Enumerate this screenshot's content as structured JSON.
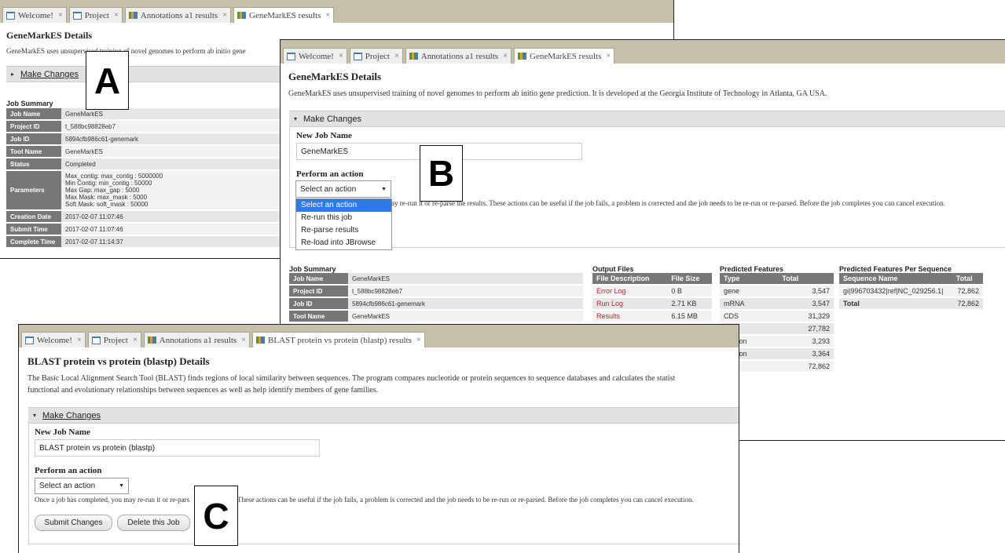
{
  "tabs": {
    "welcome": "Welcome!",
    "project": "Project",
    "annotations": "Annotations a1 results",
    "genemark": "GeneMarkES results",
    "blast": "BLAST protein vs protein (blastp) results",
    "close": "×"
  },
  "panelA": {
    "letter": "A",
    "title": "GeneMarkES Details",
    "description": "GeneMarkES uses unsupervised training of novel genomes to perform ab initio gene",
    "make_changes": "Make Changes",
    "job_summary_label": "Job Summary",
    "job_summary": [
      {
        "k": "Job Name",
        "v": "GeneMarkES"
      },
      {
        "k": "Project ID",
        "v": "t_588bc98828eb7"
      },
      {
        "k": "Job ID",
        "v": "5894cfb986c61-genemark"
      },
      {
        "k": "Tool Name",
        "v": "GeneMarkES"
      },
      {
        "k": "Status",
        "v": "Completed"
      },
      {
        "k": "Parameters",
        "v": [
          "Max_contig: max_contig : 5000000",
          "Min Contig: min_contig : 50000",
          "Max Gap: max_gap : 5000",
          "Max Mask: max_mask : 5000",
          "Soft Mask: soft_mask : 50000"
        ]
      },
      {
        "k": "Creation Date",
        "v": "2017-02-07 11:07:46"
      },
      {
        "k": "Submit Time",
        "v": "2017-02-07 11:07:46"
      },
      {
        "k": "Complete Time",
        "v": "2017-02-07 11:14:37"
      }
    ]
  },
  "panelB": {
    "letter": "B",
    "title": "GeneMarkES Details",
    "description": "GeneMarkES uses unsupervised training of novel genomes to perform ab initio gene prediction. It is developed at the Georgia Institute of Technology in Atlanta, GA USA.",
    "make_changes": "Make Changes",
    "new_job_name_label": "New Job Name",
    "new_job_name_value": "GeneMarkES",
    "perform_action_label": "Perform an action",
    "select_value": "Select an action",
    "dropdown_options": [
      "Select an action",
      "Re-run this job",
      "Re-parse results",
      "Re-load into JBrowse"
    ],
    "help_text": "ay re-run it or re-parse the results. These actions can be useful if the job fails, a problem is corrected and the job needs to be re-run or re-parsed. Before the job completes you can cancel execution.",
    "job_summary_label": "Job Summary",
    "job_summary": [
      {
        "k": "Job Name",
        "v": "GeneMarkES"
      },
      {
        "k": "Project ID",
        "v": "t_588bc98828eb7"
      },
      {
        "k": "Job ID",
        "v": "5894cfb986c61-genemark"
      },
      {
        "k": "Tool Name",
        "v": "GeneMarkES"
      }
    ],
    "output_files_label": "Output Files",
    "output_files_headers": [
      "File Description",
      "File Size"
    ],
    "output_files": [
      {
        "name": "Error Log",
        "size": "0 B"
      },
      {
        "name": "Run Log",
        "size": "2.71 KB"
      },
      {
        "name": "Results",
        "size": "6.15 MB"
      }
    ],
    "predicted_features_label": "Predicted Features",
    "predicted_features_headers": [
      "Type",
      "Total"
    ],
    "predicted_features": [
      {
        "type": "gene",
        "total": "3,547"
      },
      {
        "type": "mRNA",
        "total": "3,547"
      },
      {
        "type": "CDS",
        "total": "31,329"
      },
      {
        "type": "n",
        "total": "27,782"
      },
      {
        "type": "_codon",
        "total": "3,293"
      },
      {
        "type": "_codon",
        "total": "3,364"
      },
      {
        "type": "l",
        "total": "72,862"
      }
    ],
    "per_sequence_label": "Predicted Features Per Sequence",
    "per_sequence_headers": [
      "Sequence Name",
      "Total"
    ],
    "per_sequence": [
      {
        "name": "gi|996703432|ref|NC_029256.1|",
        "total": "72,862"
      },
      {
        "name": "Total",
        "total": "72,862"
      }
    ]
  },
  "panelC": {
    "letter": "C",
    "title": "BLAST protein vs protein (blastp) Details",
    "description_line1": "The Basic Local Alignment Search Tool (BLAST) finds regions of local similarity between sequences. The program compares nucleotide or protein sequences to sequence databases and calculates the statist",
    "description_line2": "functional and evolutionary relationships between sequences as well as help identify members of gene families.",
    "make_changes": "Make Changes",
    "new_job_name_label": "New Job Name",
    "new_job_name_value": "BLAST protein vs protein (blastp)",
    "perform_action_label": "Perform an action",
    "select_value": "Select an action",
    "help_text_left": "Once a job has completed, you may re-run it or re-pars",
    "help_text_right": "These actions can be useful if the job fails, a problem is corrected and the job needs to be re-run or re-parsed. Before the job completes you can cancel execution.",
    "submit_button": "Submit Changes",
    "delete_button": "Delete this Job"
  }
}
